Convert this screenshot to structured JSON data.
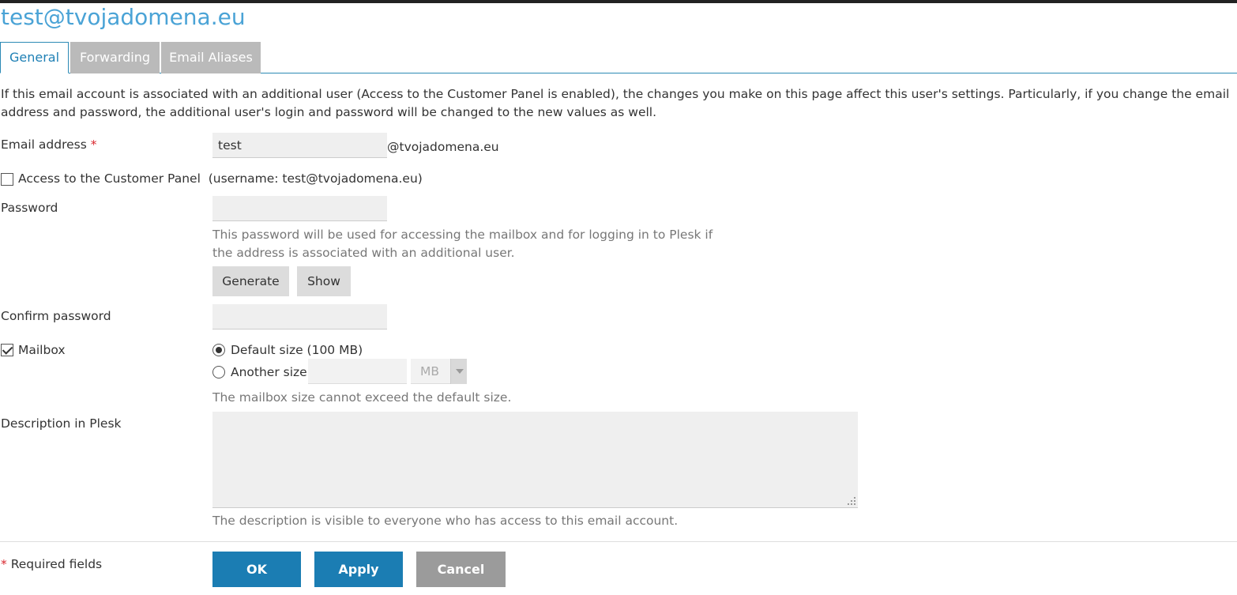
{
  "page": {
    "title": "test@tvojadomena.eu"
  },
  "tabs": [
    {
      "label": "General"
    },
    {
      "label": "Forwarding"
    },
    {
      "label": "Email Aliases"
    }
  ],
  "intro": "If this email account is associated with an additional user (Access to the Customer Panel is enabled), the changes you make on this page affect this user's settings. Particularly, if you change the email address and password, the additional user's login and password will be changed to the new values as well.",
  "form": {
    "email": {
      "label": "Email address",
      "required_mark": "*",
      "value": "test",
      "suffix": "@tvojadomena.eu"
    },
    "customer_panel": {
      "label": "Access to the Customer Panel",
      "note": "(username: test@tvojadomena.eu)",
      "checked": false
    },
    "password": {
      "label": "Password",
      "value": "",
      "hint_line1": "This password will be used for accessing the mailbox and for logging in to Plesk if",
      "hint_line2": "the address is associated with an additional user.",
      "generate_label": "Generate",
      "show_label": "Show"
    },
    "confirm_password": {
      "label": "Confirm password",
      "value": ""
    },
    "mailbox": {
      "label": "Mailbox",
      "checked": true,
      "default_size_label": "Default size (100 MB)",
      "another_size_label": "Another size",
      "selected_option": "default",
      "size_value": "",
      "unit": "MB",
      "hint": "The mailbox size cannot exceed the default size."
    },
    "description": {
      "label": "Description in Plesk",
      "value": "",
      "hint": "The description is visible to everyone who has access to this email account."
    }
  },
  "footer": {
    "required_mark": "*",
    "required_label": "Required fields",
    "ok_label": "OK",
    "apply_label": "Apply",
    "cancel_label": "Cancel"
  },
  "colors": {
    "title": "#4aa3d6",
    "tab_active_border": "#2c8ab5",
    "primary_button": "#1b7db3",
    "cancel_button": "#9b9b9b",
    "required": "#d9272e"
  }
}
